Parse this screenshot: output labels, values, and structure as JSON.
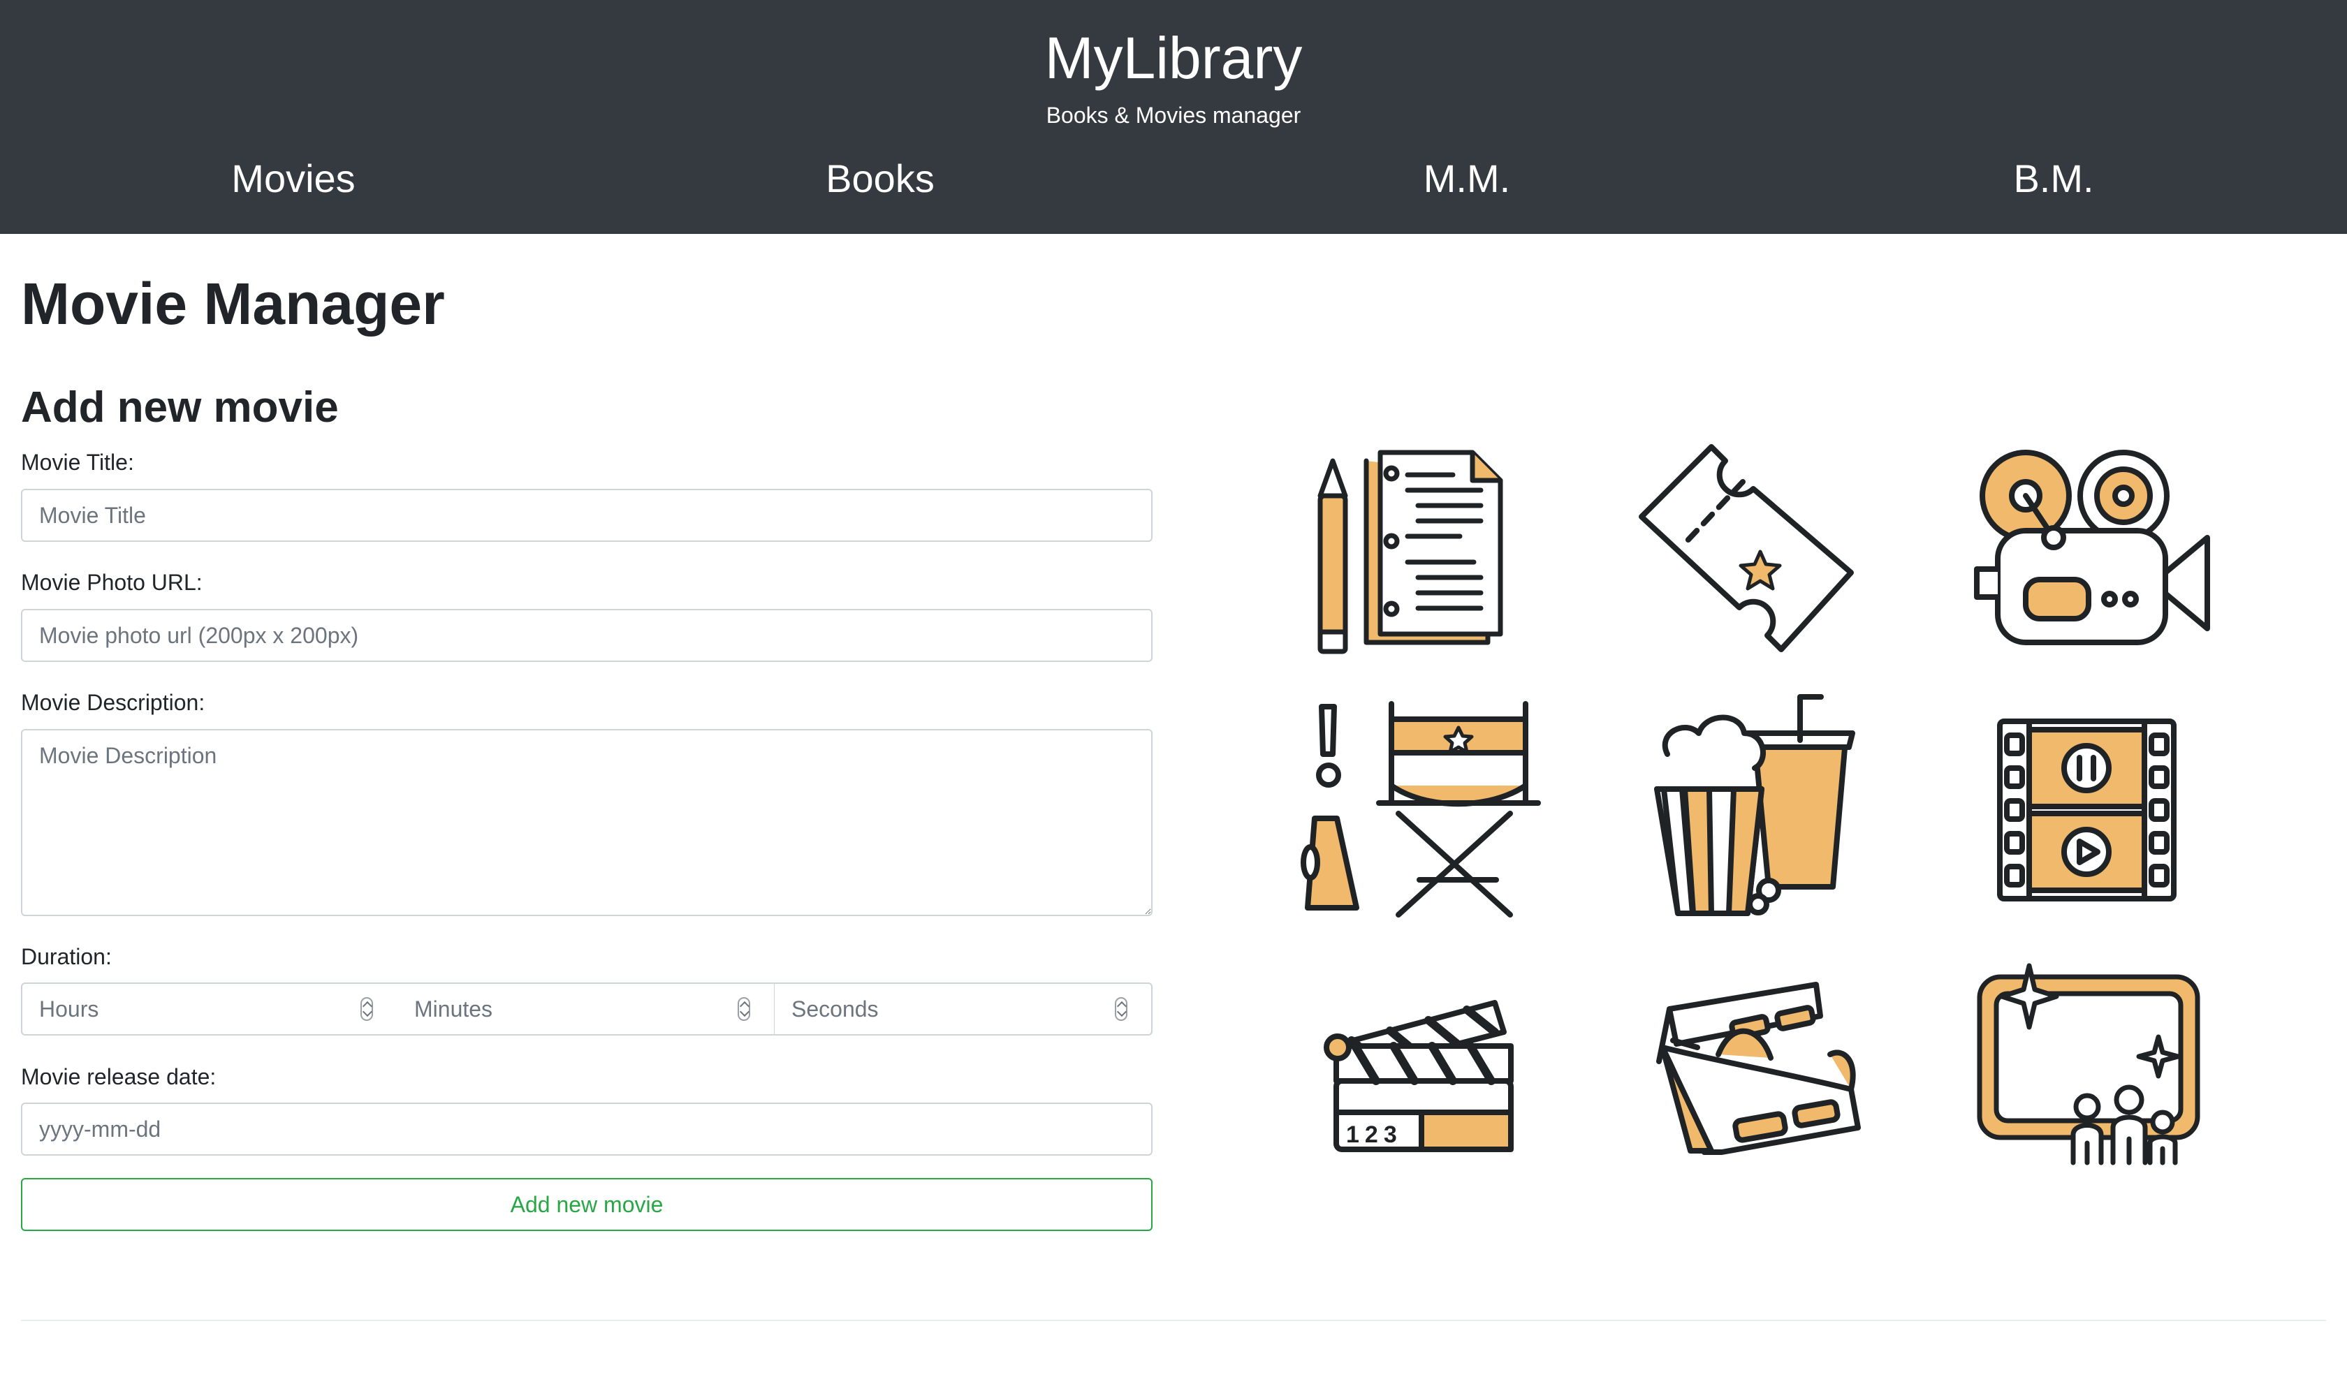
{
  "header": {
    "brand": "MyLibrary",
    "tagline": "Books & Movies manager",
    "nav": [
      {
        "label": "Movies"
      },
      {
        "label": "Books"
      },
      {
        "label": "M.M."
      },
      {
        "label": "B.M."
      }
    ]
  },
  "main": {
    "page_title": "Movie Manager",
    "form_title": "Add new movie",
    "fields": {
      "title": {
        "label": "Movie Title:",
        "placeholder": "Movie Title",
        "value": ""
      },
      "photo": {
        "label": "Movie Photo URL:",
        "placeholder": "Movie photo url (200px x 200px)",
        "value": ""
      },
      "description": {
        "label": "Movie Description:",
        "placeholder": "Movie Description",
        "value": ""
      },
      "duration": {
        "label": "Duration:",
        "hours_placeholder": "Hours",
        "minutes_placeholder": "Minutes",
        "seconds_placeholder": "Seconds"
      },
      "release": {
        "label": "Movie release date:",
        "placeholder": "yyyy-mm-dd",
        "value": ""
      }
    },
    "submit_label": "Add new movie"
  },
  "icons": [
    "script-pencil-icon",
    "ticket-icon",
    "film-camera-icon",
    "director-chair-icon",
    "popcorn-drink-icon",
    "film-strip-icon",
    "clapperboard-icon",
    "3d-glasses-icon",
    "cinema-screen-icon"
  ],
  "colors": {
    "header_bg": "#343a40",
    "accent_orange": "#f0b96b",
    "line": "#1f2326",
    "success": "#28a745"
  }
}
